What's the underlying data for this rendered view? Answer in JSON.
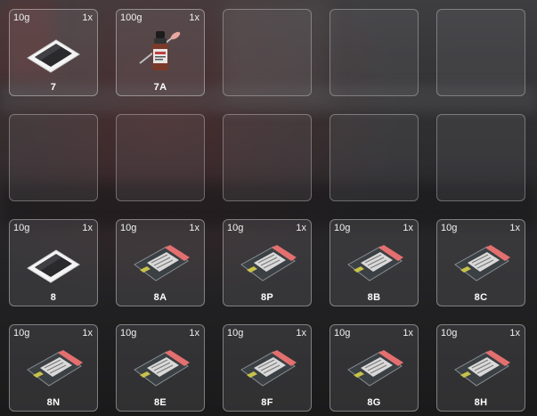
{
  "inventory": {
    "slots": [
      {
        "weight": "10g",
        "qty": "1x",
        "label": "7",
        "icon": "photo-paper-icon"
      },
      {
        "weight": "100g",
        "qty": "1x",
        "label": "7A",
        "icon": "dropper-bottle-icon"
      },
      {
        "empty": true
      },
      {
        "empty": true
      },
      {
        "empty": true
      },
      {
        "empty": true
      },
      {
        "empty": true
      },
      {
        "empty": true
      },
      {
        "empty": true
      },
      {
        "empty": true
      },
      {
        "weight": "10g",
        "qty": "1x",
        "label": "8",
        "icon": "photo-paper-icon"
      },
      {
        "weight": "10g",
        "qty": "1x",
        "label": "8A",
        "icon": "evidence-bag-icon"
      },
      {
        "weight": "10g",
        "qty": "1x",
        "label": "8P",
        "icon": "evidence-bag-icon"
      },
      {
        "weight": "10g",
        "qty": "1x",
        "label": "8B",
        "icon": "evidence-bag-icon"
      },
      {
        "weight": "10g",
        "qty": "1x",
        "label": "8C",
        "icon": "evidence-bag-icon"
      },
      {
        "weight": "10g",
        "qty": "1x",
        "label": "8N",
        "icon": "evidence-bag-icon"
      },
      {
        "weight": "10g",
        "qty": "1x",
        "label": "8E",
        "icon": "evidence-bag-icon"
      },
      {
        "weight": "10g",
        "qty": "1x",
        "label": "8F",
        "icon": "evidence-bag-icon"
      },
      {
        "weight": "10g",
        "qty": "1x",
        "label": "8G",
        "icon": "evidence-bag-icon"
      },
      {
        "weight": "10g",
        "qty": "1x",
        "label": "8H",
        "icon": "evidence-bag-icon"
      }
    ]
  }
}
